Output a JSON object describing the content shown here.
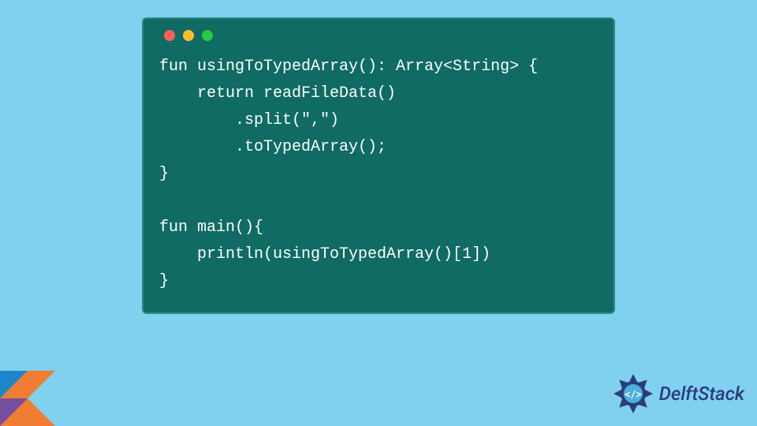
{
  "code": {
    "lines": [
      "fun usingToTypedArray(): Array<String> {",
      "    return readFileData()",
      "        .split(\",\")",
      "        .toTypedArray();",
      "}",
      "",
      "fun main(){",
      "    println(usingToTypedArray()[1])",
      "}"
    ]
  },
  "colors": {
    "page_bg": "#80d0f0",
    "card_bg": "#0f6b64",
    "card_border": "#2a8a82",
    "code_text": "#ffffff",
    "dot_red": "#ff5f56",
    "dot_yellow": "#ffbd2e",
    "dot_green": "#27c93f",
    "brand_text": "#2a3d7a"
  },
  "brand": {
    "name": "DelftStack"
  }
}
